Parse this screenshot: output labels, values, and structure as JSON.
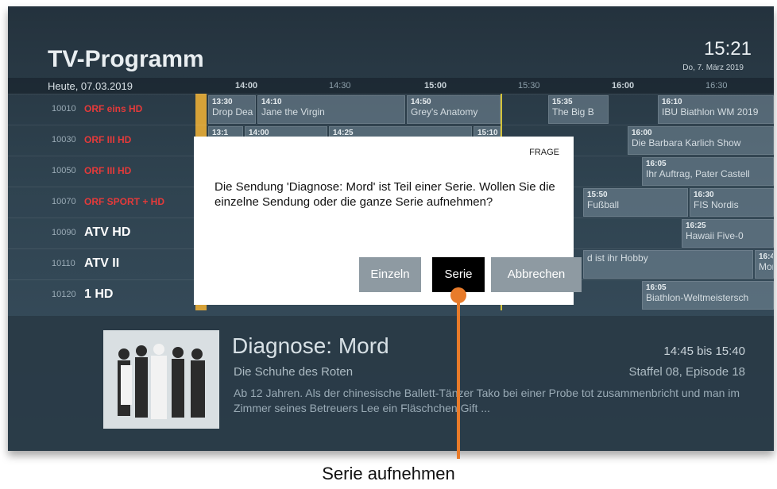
{
  "header": {
    "title": "TV-Programm",
    "clock": "15:21",
    "date": "Do, 7. März 2019"
  },
  "timebar": {
    "today": "Heute, 07.03.2019",
    "ticks": [
      "14:00",
      "14:30",
      "15:00",
      "15:30",
      "16:00",
      "16:30"
    ]
  },
  "channels": [
    {
      "number": "10010",
      "logo": "ORF eins HD"
    },
    {
      "number": "10030",
      "logo": "ORF III HD"
    },
    {
      "number": "10050",
      "logo": "ORF III HD"
    },
    {
      "number": "10070",
      "logo": "ORF SPORT + HD"
    },
    {
      "number": "10090",
      "logo": "ATV HD"
    },
    {
      "number": "10110",
      "logo": "ATV II"
    },
    {
      "number": "10120",
      "logo": "1 HD"
    }
  ],
  "events": {
    "r1": [
      {
        "time": "13:30",
        "title": "Drop Dea"
      },
      {
        "time": "14:10",
        "title": "Jane the Virgin"
      },
      {
        "time": "14:50",
        "title": "Grey's Anatomy"
      },
      {
        "time": "15:35",
        "title": "The Big B"
      },
      {
        "time": "16:10",
        "title": "IBU Biathlon WM 2019"
      }
    ],
    "r2": [
      {
        "time": "13:1",
        "title": ""
      },
      {
        "time": "14:00",
        "title": ""
      },
      {
        "time": "14:25",
        "title": ""
      },
      {
        "time": "15:10",
        "title": ""
      },
      {
        "time": "16:00",
        "title": "Die Barbara Karlich Show"
      }
    ],
    "r3": [
      {
        "time": "16:05",
        "title": "Ihr Auftrag, Pater Castell"
      }
    ],
    "r4": [
      {
        "time": "15:50",
        "title": "Fußball"
      },
      {
        "time": "16:30",
        "title": "FIS Nordis"
      }
    ],
    "r5": [
      {
        "time": "16:25",
        "title": "Hawaii Five-0"
      }
    ],
    "r6": [
      {
        "time": "",
        "title": "d ist ihr Hobby"
      },
      {
        "time": "16:4",
        "title": "Mon"
      }
    ],
    "r7": [
      {
        "time": "16:05",
        "title": "Biathlon-Weltmeistersch"
      }
    ]
  },
  "detail": {
    "title": "Diagnose: Mord",
    "subtitle": "Die Schuhe des Roten",
    "time": "14:45 bis 15:40",
    "season": "Staffel 08, Episode 18",
    "description": "Ab 12 Jahren. Als der chinesische Ballett-Tänzer Tako bei einer Probe tot zusammenbricht und man im Zimmer seines Betreuers Lee ein Fläschchen Gift ..."
  },
  "dialog": {
    "header": "FRAGE",
    "text": "Die Sendung 'Diagnose: Mord' ist Teil einer Serie. Wollen Sie die einzelne Sendung oder die ganze Serie aufnehmen?",
    "buttons": {
      "single": "Einzeln",
      "series": "Serie",
      "cancel": "Abbrechen"
    }
  },
  "callout": {
    "label": "Serie aufnehmen"
  },
  "colors": {
    "accent": "#e87b2a",
    "lane": "#d6a238",
    "orf": "#e53a3a"
  }
}
